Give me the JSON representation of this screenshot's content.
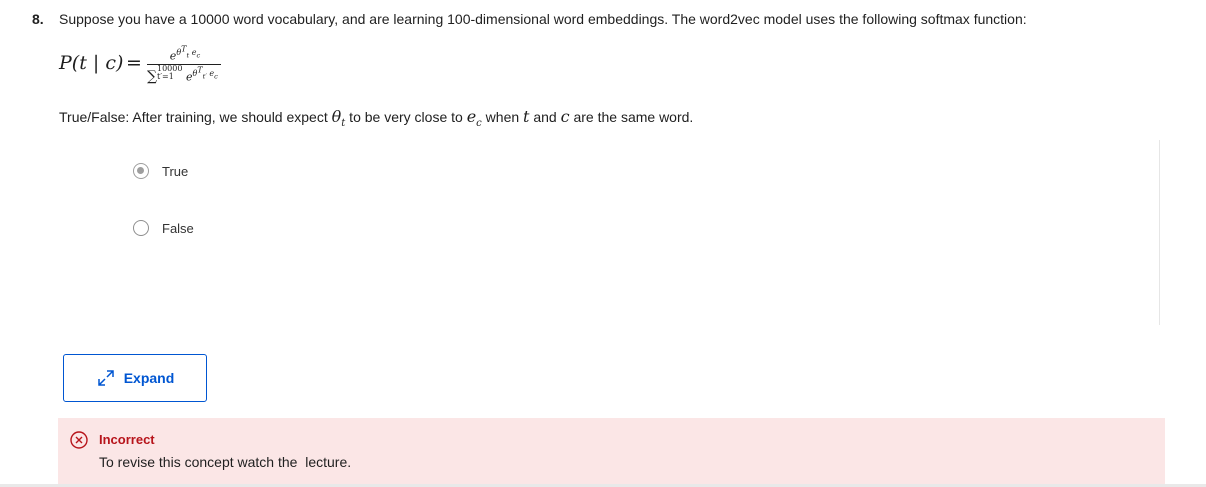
{
  "question": {
    "number": "8.",
    "text": "Suppose you have a 10000 word vocabulary, and are learning 100-dimensional word embeddings. The word2vec model uses the following softmax function:",
    "formula": {
      "lhs": "P(t | c)",
      "eq": "=",
      "numerator_base": "e",
      "numerator_exp": "θ",
      "numerator_exp_sup": "T",
      "numerator_exp_sub": "t",
      "numerator_exp_tail": "e",
      "numerator_exp_tail_sub": "c",
      "denominator_sigma": "∑",
      "denominator_upper": "10000",
      "denominator_lower": "t′=1",
      "denominator_base": "e",
      "denominator_exp": "θ",
      "denominator_exp_sup": "T",
      "denominator_exp_sub": "t′",
      "denominator_exp_tail": "e",
      "denominator_exp_tail_sub": "c"
    },
    "statement": {
      "prefix": "True/False: After training, we should expect ",
      "theta": "θ",
      "theta_sub": "t",
      "mid1": " to be very close to ",
      "e": "e",
      "e_sub": "c",
      "mid2": " when ",
      "t": "t",
      "mid3": " and ",
      "c": "c",
      "suffix": " are the same word."
    },
    "options": [
      {
        "label": "True",
        "selected": true
      },
      {
        "label": "False",
        "selected": false
      }
    ]
  },
  "expand_button": {
    "label": "Expand",
    "icon": "expand-arrows-icon"
  },
  "feedback": {
    "status": "Incorrect",
    "message": "To revise this concept watch the  lecture.",
    "icon": "x-circle-icon",
    "color": "#b7141b",
    "background": "#fbe6e6"
  },
  "colors": {
    "accent": "#0056d2",
    "text": "#1f1f1f"
  }
}
